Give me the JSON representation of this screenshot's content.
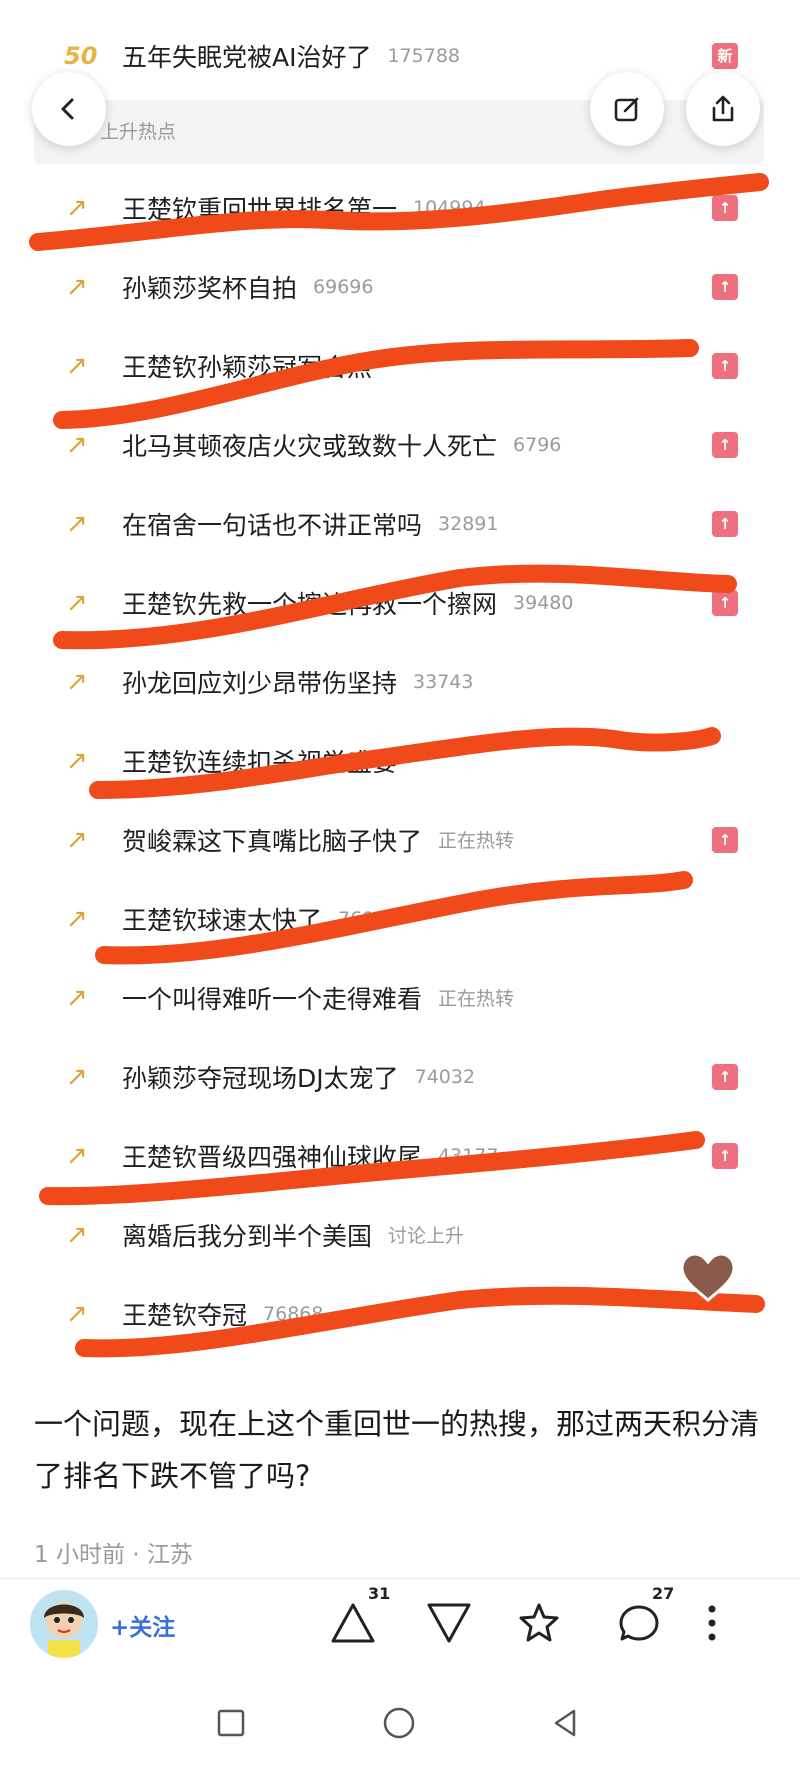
{
  "top_item": {
    "rank": "50",
    "title": "五年失眠党被AI治好了",
    "heat": "175788",
    "badge": "新"
  },
  "section_label": "上升热点",
  "items": [
    {
      "title": "王楚钦重回世界排名第一",
      "heat": "104994",
      "badge": "↑"
    },
    {
      "title": "孙颖莎奖杯自拍",
      "heat": "69696",
      "badge": "↑"
    },
    {
      "title": "王楚钦孙颖莎冠军合照",
      "heat": "",
      "badge": "↑"
    },
    {
      "title": "北马其顿夜店火灾或致数十人死亡",
      "heat": "6796",
      "badge": "↑"
    },
    {
      "title": "在宿舍一句话也不讲正常吗",
      "heat": "32891",
      "badge": "↑"
    },
    {
      "title": "王楚钦先救一个擦边再救一个擦网",
      "heat": "39480",
      "badge": "↑"
    },
    {
      "title": "孙龙回应刘少昂带伤坚持",
      "heat": "33743",
      "badge": ""
    },
    {
      "title": "王楚钦连续扣杀视觉盛宴",
      "heat": "",
      "badge": ""
    },
    {
      "title": "贺峻霖这下真嘴比脑子快了",
      "heat": "正在热转",
      "badge": "↑"
    },
    {
      "title": "王楚钦球速太快了",
      "heat": "76932",
      "badge": ""
    },
    {
      "title": "一个叫得难听一个走得难看",
      "heat": "正在热转",
      "badge": ""
    },
    {
      "title": "孙颖莎夺冠现场DJ太宠了",
      "heat": "74032",
      "badge": "↑"
    },
    {
      "title": "王楚钦晋级四强神仙球收尾",
      "heat": "43177",
      "badge": "↑"
    },
    {
      "title": "离婚后我分到半个美国",
      "heat": "讨论上升",
      "badge": ""
    },
    {
      "title": "王楚钦夺冠",
      "heat": "76868",
      "badge": ""
    }
  ],
  "comment": {
    "text": "一个问题，现在上这个重回世一的热搜，那过两天积分清了排名下跌不管了吗?",
    "meta": "1 小时前 · 江苏"
  },
  "actions": {
    "follow_label": "+关注",
    "like_count": "31",
    "comment_count": "27"
  },
  "colors": {
    "badge": "#ee6f7e",
    "arrow": "#e0a23a",
    "marker": "#f04a1a",
    "follow": "#3b6fd8"
  },
  "icons": [
    "back-icon",
    "edit-icon",
    "share-icon",
    "arrow-up-icon",
    "dislike-icon",
    "star-icon",
    "comment-icon",
    "more-icon",
    "square-nav-icon",
    "circle-nav-icon",
    "triangle-nav-icon"
  ]
}
